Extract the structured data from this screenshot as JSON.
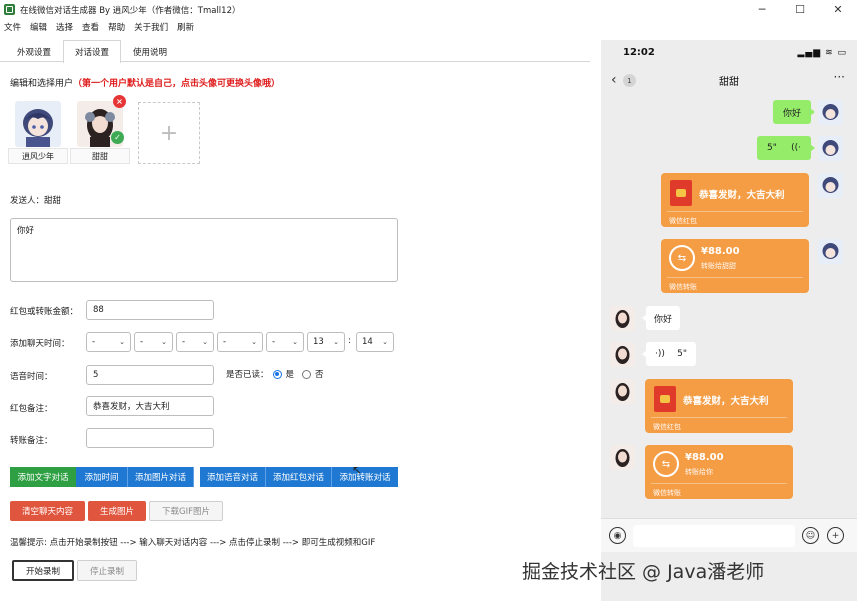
{
  "window": {
    "title": "在线微信对话生成器 By 逍风少年（作者微信：Tmall12）",
    "minimize": "─",
    "maximize": "☐",
    "close": "✕"
  },
  "menu": [
    "文件",
    "编辑",
    "选择",
    "查看",
    "帮助",
    "关于我们",
    "刷新"
  ],
  "tabs": [
    "外观设置",
    "对话设置",
    "使用说明"
  ],
  "active_tab": "对话设置",
  "section": {
    "title": "编辑和选择用户",
    "warning": "（第一个用户默认是自己，点击头像可更换头像哦）"
  },
  "users": [
    {
      "name": "逍风少年",
      "selected": false
    },
    {
      "name": "甜甜",
      "selected": true
    }
  ],
  "add_user_icon": "+",
  "sender": {
    "label": "发送人：",
    "name": "甜甜"
  },
  "message": {
    "value": "你好"
  },
  "form": {
    "amount_label": "红包或转账金额：",
    "amount_value": "88",
    "time_label": "添加聊天时间：",
    "time_selects": [
      "-",
      "-",
      "-",
      "-",
      "-",
      "13",
      "14"
    ],
    "time_colon": ":",
    "voice_label": "语音时间：",
    "voice_value": "5",
    "read_label": "是否已读：",
    "read_yes": "是",
    "read_no": "否",
    "redpack_note_label": "红包备注：",
    "redpack_note_value": "恭喜发财，大吉大利",
    "transfer_note_label": "转账备注：",
    "transfer_note_value": ""
  },
  "buttons": {
    "add_text": "添加文字对话",
    "add_time": "添加时间",
    "add_image": "添加图片对话",
    "add_voice": "添加语音对话",
    "add_redpack": "添加红包对话",
    "add_transfer": "添加转账对话",
    "clear": "清空聊天内容",
    "gen_image": "生成图片",
    "download_gif": "下载GIF图片",
    "start_record": "开始录制",
    "stop_record": "停止录制"
  },
  "tip": "温馨提示: 点击开始录制按钮 ---> 输入聊天对话内容 ---> 点击停止录制 ---> 即可生成视频和GIF",
  "phone": {
    "time": "12:02",
    "status_icons": "▂▄▆ ≋ ▭",
    "back": "‹",
    "unread": "1",
    "chat_title": "甜甜",
    "more": "···",
    "messages": {
      "me_text": "你好",
      "me_voice": "5\"",
      "me_voice_icon": "((·",
      "me_redpack_text": "恭喜发财，大吉大利",
      "me_redpack_foot": "微信红包",
      "me_transfer_amount": "¥88.00",
      "me_transfer_sub": "转账给甜甜",
      "me_transfer_foot": "微信转账",
      "other_text": "你好",
      "other_voice": "5\"",
      "other_voice_icon": "·))",
      "other_redpack_text": "恭喜发财，大吉大利",
      "other_redpack_foot": "微信红包",
      "other_transfer_amount": "¥88.00",
      "other_transfer_sub": "转账给你",
      "other_transfer_foot": "微信转账",
      "transfer_glyph": "⇆"
    },
    "input_icons": {
      "voice": "◉",
      "emoji": "☺",
      "plus": "+"
    }
  },
  "watermark": "掘金技术社区 @ Java潘老师"
}
